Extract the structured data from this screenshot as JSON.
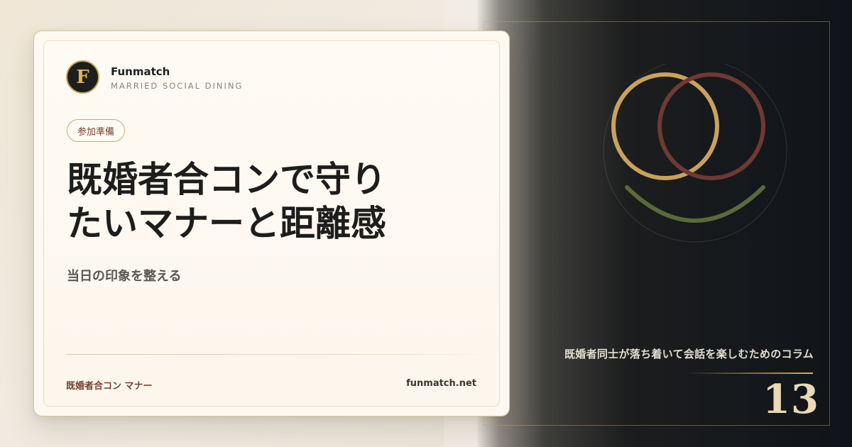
{
  "brand": {
    "logo_letter": "F",
    "name": "Funmatch",
    "tagline": "MARRIED SOCIAL DINING"
  },
  "article": {
    "category": "参加準備",
    "headline_line1": "既婚者合コンで守り",
    "headline_line2": "たいマナーと距離感",
    "subtitle": "当日の印象を整える"
  },
  "footer": {
    "keyword": "既婚者合コン マナー",
    "domain": "funmatch.net"
  },
  "side_panel": {
    "caption": "既婚者同士が落ち着いて会話を楽しむためのコラム",
    "issue_number": "13"
  },
  "colors": {
    "accent_gold": "#d6af69",
    "ring_gold": "#c9a25c",
    "ring_red": "#6e3a31",
    "arc_green": "#5a6a3a",
    "dark_panel": "#15181c",
    "card_bg": "#fdf9f1"
  },
  "icons": {
    "logo": "letter-f-monogram",
    "emblem": "interlocking-rings-smile"
  }
}
